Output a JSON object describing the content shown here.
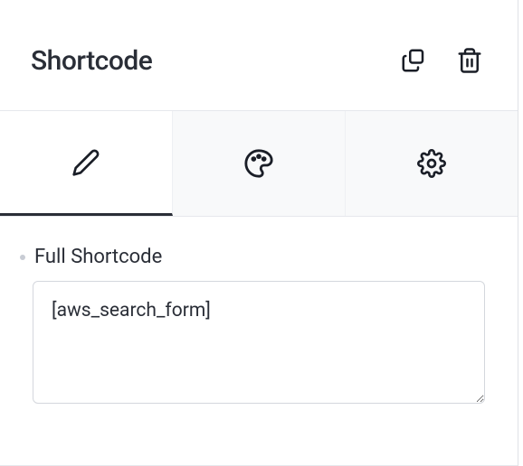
{
  "header": {
    "title": "Shortcode"
  },
  "tabs": {
    "edit": "edit",
    "style": "style",
    "settings": "settings"
  },
  "content": {
    "field_label": "Full Shortcode",
    "field_value": "[aws_search_form]"
  }
}
